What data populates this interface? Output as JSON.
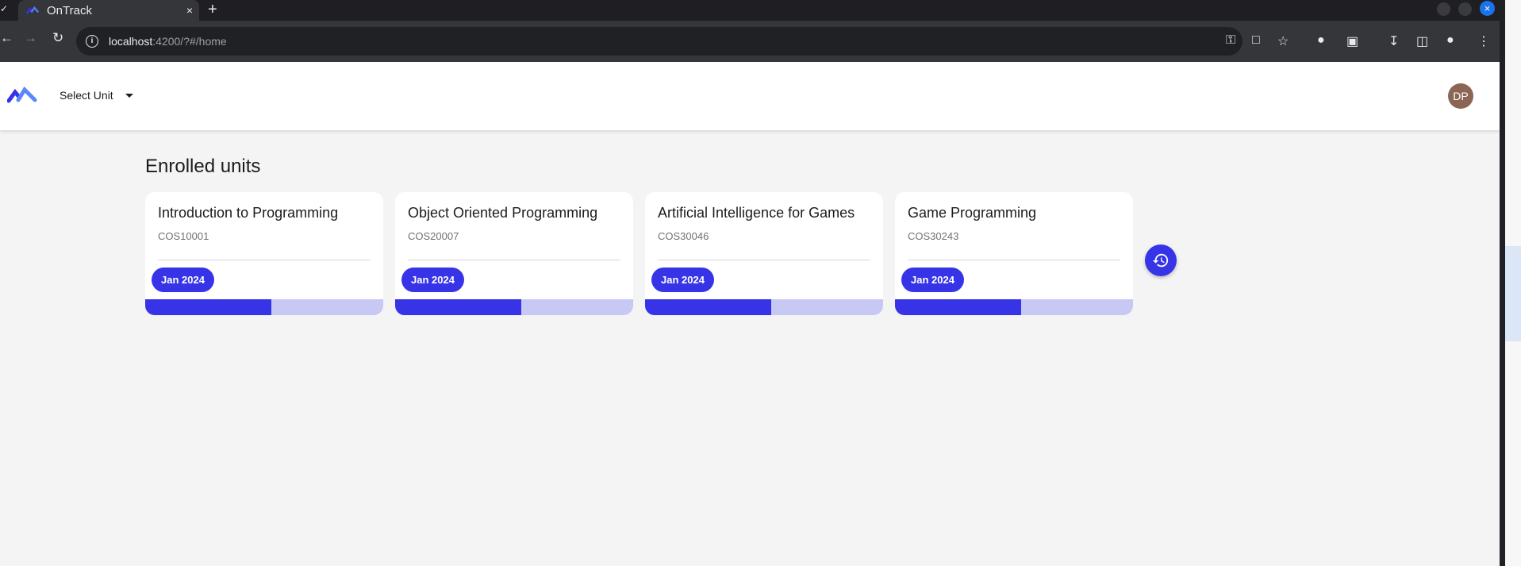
{
  "browser": {
    "tab_title": "OnTrack",
    "tab_close": "×",
    "new_tab": "+",
    "url_host": "localhost",
    "url_rest": ":4200/?#/home",
    "window_close": "×"
  },
  "header": {
    "unit_select_label": "Select Unit",
    "avatar_initials": "DP"
  },
  "main": {
    "heading": "Enrolled units",
    "units": [
      {
        "name": "Introduction to Programming",
        "code": "COS10001",
        "period": "Jan 2024",
        "progress": 0.53
      },
      {
        "name": "Object Oriented Programming",
        "code": "COS20007",
        "period": "Jan 2024",
        "progress": 0.53
      },
      {
        "name": "Artificial Intelligence for Games",
        "code": "COS30046",
        "period": "Jan 2024",
        "progress": 0.53
      },
      {
        "name": "Game Programming",
        "code": "COS30243",
        "period": "Jan 2024",
        "progress": 0.53
      }
    ]
  },
  "colors": {
    "accent": "#3734e8",
    "accent_light": "#c8c8f5",
    "avatar_bg": "#8c6655"
  },
  "icons": [
    "back-arrow-icon",
    "forward-arrow-icon",
    "reload-icon",
    "site-info-icon",
    "key-icon",
    "install-icon",
    "star-icon",
    "extension-badge-icon",
    "puzzle-icon",
    "download-icon",
    "side-panel-icon",
    "profile-icon",
    "more-menu-icon",
    "history-icon"
  ]
}
